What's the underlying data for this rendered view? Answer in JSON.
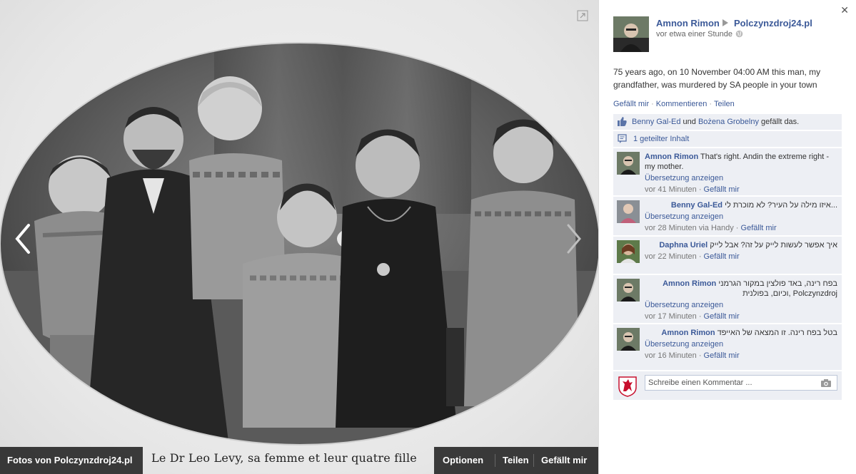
{
  "photo": {
    "printed_caption": "Le Dr Leo Levy, sa femme et leur quatre fille",
    "prev_label": "Previous photo",
    "next_label": "Next photo"
  },
  "bottom_bar": {
    "album_link": "Fotos von Polczynzdroj24.pl",
    "options": "Optionen",
    "share": "Teilen",
    "like": "Gefällt mir"
  },
  "post": {
    "author": "Amnon Rimon",
    "page": "Polczynzdroj24.pl",
    "time": "vor etwa einer Stunde",
    "text": "75 years ago, on 10 November 04:00 AM this man, my grandfather, was murdered by SA people in your town",
    "actions": {
      "like": "Gefällt mir",
      "comment": "Kommentieren",
      "share": "Teilen"
    }
  },
  "likes": {
    "person1": "Benny Gal-Ed",
    "and_word": "und",
    "person2": "Bożena Grobelny",
    "suffix": "gefällt das."
  },
  "shares": {
    "label": "1 geteilter Inhalt"
  },
  "comments": [
    {
      "author": "Amnon Rimon",
      "text": "That's right. Andin the extreme right - my mother.",
      "translate": "Übersetzung anzeigen",
      "time": "vor 41 Minuten",
      "via": "",
      "like": "Gefällt mir"
    },
    {
      "author": "Benny Gal-Ed",
      "text": "איזו מילה על העיר? לא מוכרת לי...",
      "translate": "Übersetzung anzeigen",
      "time": "vor 28 Minuten",
      "via": "via Handy",
      "like": "Gefällt mir"
    },
    {
      "author": "Daphna Uriel",
      "text": "איך אפשר לעשות לייק על זה? אבל לייק",
      "translate": "",
      "time": "vor 22 Minuten",
      "via": "",
      "like": "Gefällt mir"
    },
    {
      "author": "Amnon Rimon",
      "text": "בפח רינה, באד פולצין במקור הגרמני וכיום, בפולנית, Polczynzdroj",
      "translate": "Übersetzung anzeigen",
      "time": "vor 17 Minuten",
      "via": "",
      "like": "Gefällt mir"
    },
    {
      "author": "Amnon Rimon",
      "text": "בטל בפח רינה. זו המצאה של האייפד",
      "translate": "Übersetzung anzeigen",
      "time": "vor 16 Minuten",
      "via": "",
      "like": "Gefällt mir"
    }
  ],
  "compose": {
    "placeholder": "Schreibe einen Kommentar ..."
  },
  "colors": {
    "link": "#3b5998",
    "panel_row": "#edeff4",
    "bar": "#141414"
  },
  "icons": [
    "expand-icon",
    "close-icon",
    "chevron-left-icon",
    "chevron-right-icon",
    "arrow-right-icon",
    "globe-icon",
    "thumbs-up-icon",
    "share-icon",
    "camera-icon",
    "griffin-crest-icon"
  ]
}
